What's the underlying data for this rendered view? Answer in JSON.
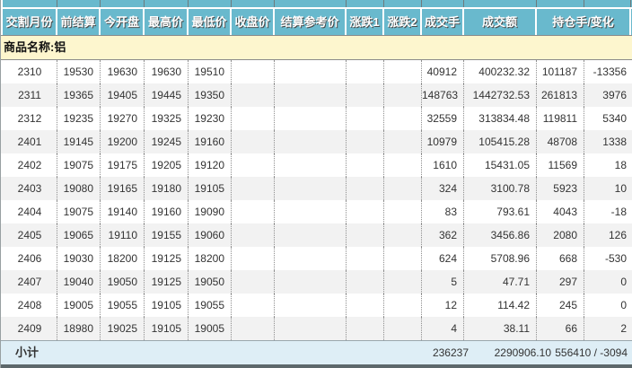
{
  "table": {
    "headers": [
      "交割月份",
      "前结算",
      "今开盘",
      "最高价",
      "最低价",
      "收盘价",
      "结算参考价",
      "涨跌1",
      "涨跌2",
      "成交手",
      "成交额",
      "持仓手/变化"
    ],
    "group_label": "商品名称:铝",
    "rows": [
      [
        "2310",
        "19530",
        "19630",
        "19630",
        "19510",
        "",
        "",
        "",
        "",
        "40912",
        "400232.32",
        "101187",
        "-13356"
      ],
      [
        "2311",
        "19365",
        "19405",
        "19445",
        "19350",
        "",
        "",
        "",
        "",
        "148763",
        "1442732.53",
        "261813",
        "3976"
      ],
      [
        "2312",
        "19235",
        "19270",
        "19325",
        "19230",
        "",
        "",
        "",
        "",
        "32559",
        "313834.48",
        "119811",
        "5340"
      ],
      [
        "2401",
        "19145",
        "19200",
        "19245",
        "19160",
        "",
        "",
        "",
        "",
        "10979",
        "105415.28",
        "48708",
        "1338"
      ],
      [
        "2402",
        "19075",
        "19175",
        "19205",
        "19120",
        "",
        "",
        "",
        "",
        "1610",
        "15431.05",
        "11569",
        "18"
      ],
      [
        "2403",
        "19080",
        "19165",
        "19180",
        "19105",
        "",
        "",
        "",
        "",
        "324",
        "3100.78",
        "5923",
        "10"
      ],
      [
        "2404",
        "19075",
        "19140",
        "19160",
        "19090",
        "",
        "",
        "",
        "",
        "83",
        "793.61",
        "4043",
        "-18"
      ],
      [
        "2405",
        "19065",
        "19110",
        "19155",
        "19060",
        "",
        "",
        "",
        "",
        "362",
        "3456.86",
        "2080",
        "126"
      ],
      [
        "2406",
        "19030",
        "18200",
        "19125",
        "18200",
        "",
        "",
        "",
        "",
        "624",
        "5708.96",
        "668",
        "-530"
      ],
      [
        "2407",
        "19040",
        "19050",
        "19125",
        "19050",
        "",
        "",
        "",
        "",
        "5",
        "47.71",
        "297",
        "0"
      ],
      [
        "2408",
        "19005",
        "19055",
        "19105",
        "19055",
        "",
        "",
        "",
        "",
        "12",
        "114.42",
        "245",
        "0"
      ],
      [
        "2409",
        "18980",
        "19025",
        "19105",
        "19005",
        "",
        "",
        "",
        "",
        "4",
        "38.11",
        "66",
        "2"
      ]
    ],
    "subtotal": {
      "label": "小计",
      "volume": "236237",
      "turnover": "2290906.10",
      "oi_change": "556410 / -3094"
    }
  },
  "colors": {
    "header_bg": "#69B9CD",
    "header_text": "#FFFFFF",
    "group_bg": "#FDF6CE",
    "row_alt_bg": "#F2F2F2",
    "subtotal_bg": "#DEEEF6",
    "bottom_bar": "#5D686B"
  }
}
